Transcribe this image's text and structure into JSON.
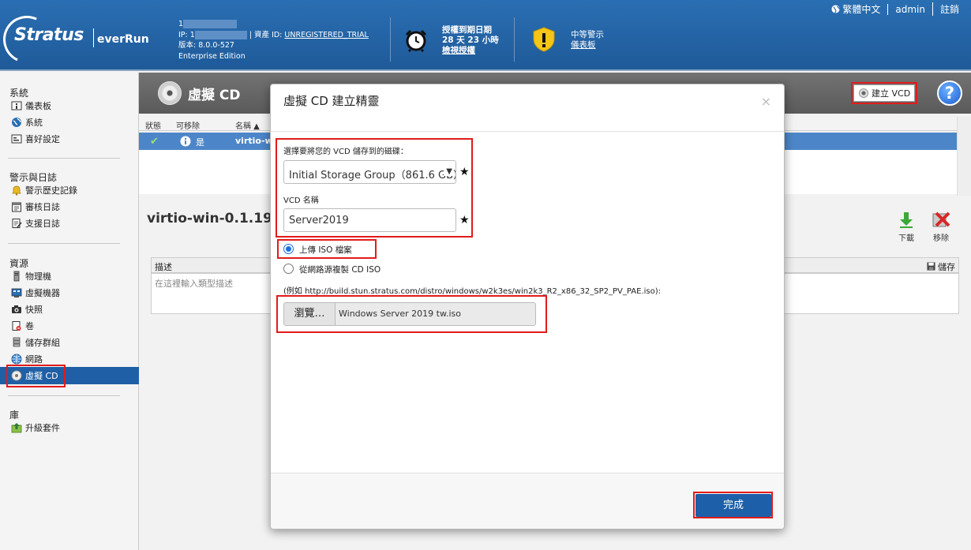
{
  "header": {
    "logo_brand": "Stratus",
    "logo_product": "everRun",
    "sys_line1": "1",
    "ip_label": "IP: 1",
    "asset_label": "| 資產 ID:",
    "asset_value": "UNREGISTERED_TRIAL",
    "version": "版本: 8.0.0-527",
    "edition": "Enterprise Edition",
    "license_title": "授權到期日期",
    "license_days": "28 天 23 小時",
    "license_link": "檢視授權",
    "alert_title": "中等警示",
    "alert_link": "儀表板",
    "language": "繁體中文",
    "user": "admin",
    "logout": "註銷"
  },
  "sidebar": {
    "sections": [
      {
        "title": "系統",
        "items": [
          "儀表板",
          "系統",
          "喜好設定"
        ]
      },
      {
        "title": "警示與日誌",
        "items": [
          "警示歷史記錄",
          "審核日誌",
          "支援日誌"
        ]
      },
      {
        "title": "資源",
        "items": [
          "物理機",
          "虛擬機器",
          "快照",
          "卷",
          "儲存群組",
          "網路",
          "虛擬 CD"
        ]
      },
      {
        "title": "庫",
        "items": [
          "升級套件"
        ]
      }
    ]
  },
  "main": {
    "title": "虛擬 CD",
    "create_button": "建立 VCD",
    "help": "?",
    "columns": {
      "status": "狀態",
      "removable": "可移除",
      "name": "名稱 ▲"
    },
    "row": {
      "status": "✔",
      "removable": "是",
      "name": "virtio-win"
    },
    "detail_title": "virtio-win-0.1.190_",
    "download": "下載",
    "remove": "移除",
    "desc_label": "描述",
    "save": "儲存",
    "desc_placeholder": "在這裡輸入類型描述"
  },
  "modal": {
    "title": "虛擬 CD 建立精靈",
    "close": "×",
    "storage_label": "選擇要將您的 VCD 儲存到的磁碟：",
    "storage_value": "Initial Storage Group（861.6 GB）",
    "star": "★",
    "name_label": "VCD 名稱",
    "name_value": "Server2019",
    "option_upload": "上傳 ISO 檔案",
    "option_network": "從網路源複製 CD ISO",
    "example": "(例如 http://build.stun.stratus.com/distro/windows/w2k3es/win2k3_R2_x86_32_SP2_PV_PAE.iso):",
    "browse": "瀏覽…",
    "file": "Windows Server 2019 tw.iso",
    "finish": "完成"
  },
  "colors": {
    "header": "#1f5a99",
    "accent": "#1d5fa8",
    "highlight": "#e21b1b"
  }
}
